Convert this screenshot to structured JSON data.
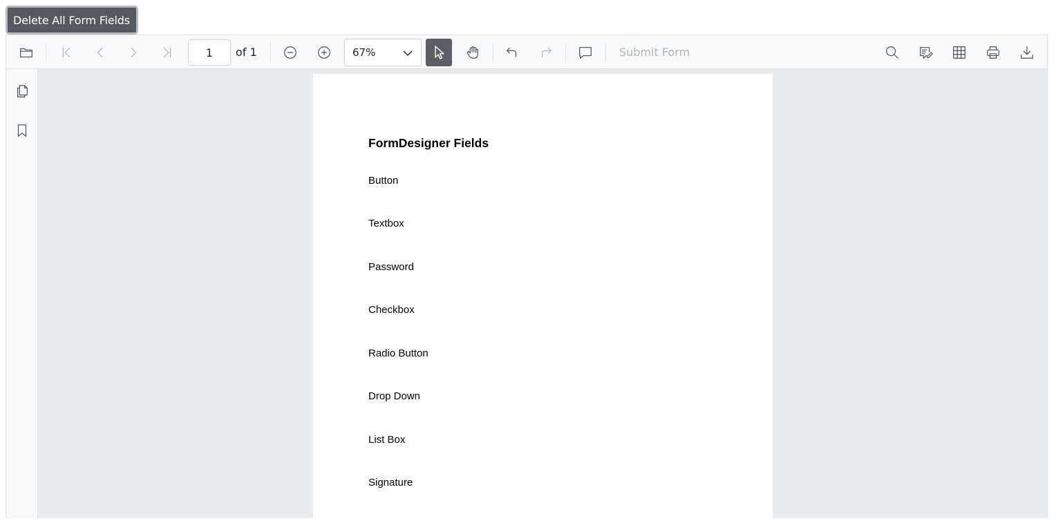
{
  "top": {
    "delete_button": "Delete All Form Fields"
  },
  "toolbar": {
    "page_number": "1",
    "page_total_label": "of 1",
    "zoom_value": "67%",
    "submit_form": "Submit Form",
    "icons": [
      "open-folder-icon",
      "first-page-icon",
      "previous-page-icon",
      "next-page-icon",
      "last-page-icon",
      "zoom-out-icon",
      "zoom-in-icon",
      "chevron-down-icon",
      "selection-pointer-icon",
      "pan-hand-icon",
      "undo-icon",
      "redo-icon",
      "comment-icon",
      "search-icon",
      "annotation-edit-icon",
      "form-designer-icon",
      "print-icon",
      "download-icon"
    ]
  },
  "sidebar": {
    "icons": [
      "page-thumbnails-icon",
      "bookmark-icon"
    ]
  },
  "document": {
    "title": "FormDesigner Fields",
    "fields": [
      "Button",
      "Textbox",
      "Password",
      "Checkbox",
      "Radio Button",
      "Drop Down",
      "List Box",
      "Signature"
    ]
  }
}
